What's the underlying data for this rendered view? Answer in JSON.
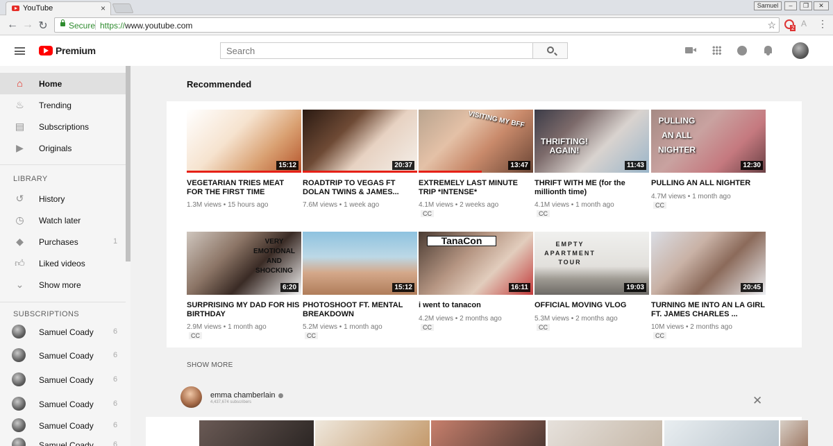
{
  "browser": {
    "tab_title": "YouTube",
    "tab_close": "×",
    "profile_name": "Samuel",
    "secure_label": "Secure",
    "url_scheme": "https://",
    "url_host": "www.youtube.com",
    "ext_badge": "2"
  },
  "header": {
    "brand": "Premium",
    "search_placeholder": "Search"
  },
  "sidebar": {
    "main": [
      {
        "label": "Home",
        "icon": "home-icon"
      },
      {
        "label": "Trending",
        "icon": "flame-icon"
      },
      {
        "label": "Subscriptions",
        "icon": "subscriptions-icon"
      },
      {
        "label": "Originals",
        "icon": "originals-icon"
      }
    ],
    "library_heading": "LIBRARY",
    "library": [
      {
        "label": "History",
        "icon": "history-icon",
        "count": ""
      },
      {
        "label": "Watch later",
        "icon": "clock-icon",
        "count": ""
      },
      {
        "label": "Purchases",
        "icon": "tag-icon",
        "count": "1"
      },
      {
        "label": "Liked videos",
        "icon": "thumbs-up-icon",
        "count": ""
      },
      {
        "label": "Show more",
        "icon": "chevron-down-icon",
        "count": ""
      }
    ],
    "subscriptions_heading": "SUBSCRIPTIONS",
    "subscriptions": [
      {
        "label": "Samuel Coady",
        "count": "6"
      },
      {
        "label": "Samuel Coady",
        "count": "6"
      },
      {
        "label": "Samuel Coady",
        "count": "6"
      },
      {
        "label": "Samuel Coady",
        "count": "6"
      },
      {
        "label": "Samuel Coady",
        "count": "6"
      },
      {
        "label": "Samuel Coady",
        "count": "6"
      }
    ]
  },
  "recommended": {
    "heading": "Recommended",
    "videos": [
      {
        "title": "VEGETARIAN TRIES MEAT FOR THE FIRST TIME",
        "meta": "1.3M views • 15 hours ago",
        "duration": "15:12",
        "cc": "",
        "thumb_text": "",
        "bg": "linear-gradient(135deg,#ffffff 0%,#f6e3cf 40%,#d9a071 70%,#b5542c 100%)"
      },
      {
        "title": "ROADTRIP TO VEGAS FT DOLAN TWINS & JAMES...",
        "meta": "7.6M views • 1 week ago",
        "duration": "20:37",
        "cc": "",
        "thumb_text": "",
        "bg": "linear-gradient(135deg,#2a1a12 0%,#6e4a35 35%,#e7d2c2 60%,#f4efe9 100%)"
      },
      {
        "title": "EXTREMELY LAST MINUTE TRIP *INTENSE*",
        "meta": "4.1M views • 2 weeks ago",
        "duration": "13:47",
        "cc": "CC",
        "thumb_text": "VISITING MY BFF",
        "bg": "linear-gradient(135deg,#b9a48f 0%,#e4c1a7 35%,#c98a6b 60%,#6a4535 100%)"
      },
      {
        "title": "THRIFT WITH ME (for the millionth time)",
        "meta": "4.1M views • 1 month ago",
        "duration": "11:43",
        "cc": "CC",
        "thumb_text": "THRIFTING! AGAIN!",
        "bg": "linear-gradient(135deg,#3c3c48 0%,#7c6a6a 30%,#d9d3cf 60%,#9ab5c9 100%)"
      },
      {
        "title": "PULLING AN ALL NIGHTER",
        "meta": "4.7M views • 1 month ago",
        "duration": "12:30",
        "cc": "CC",
        "thumb_text": "PULLING AN ALL NIGHTER",
        "bg": "linear-gradient(135deg,#a58a84 0%,#c9a2a0 40%,#c5797f 70%,#6a4145 100%)"
      },
      {
        "title": "SURPRISING MY DAD FOR HIS BIRTHDAY",
        "meta": "2.9M views • 1 month ago",
        "duration": "6:20",
        "cc": "CC",
        "thumb_text": "VERY EMOTIONAL AND SHOCKING",
        "bg": "linear-gradient(135deg,#cfc6be 0%,#8c7566 35%,#3a2b25 60%,#f2f2f2 100%)"
      },
      {
        "title": "PHOTOSHOOT FT. MENTAL BREAKDOWN",
        "meta": "5.2M views • 1 month ago",
        "duration": "15:12",
        "cc": "CC",
        "thumb_text": "",
        "bg": "linear-gradient(180deg,#8ec2df 0%,#bcd8e6 40%,#d4a88a 65%,#b07d5a 100%)"
      },
      {
        "title": "i went to tanacon",
        "meta": "4.2M views • 2 months ago",
        "duration": "16:11",
        "cc": "CC",
        "thumb_text": "TanaCon",
        "bg": "linear-gradient(135deg,#4a3b32 0%,#b59582 40%,#e2cdbd 65%,#c23a3a 100%)"
      },
      {
        "title": "OFFICIAL MOVING VLOG",
        "meta": "5.3M views • 2 months ago",
        "duration": "19:03",
        "cc": "CC",
        "thumb_text": "EMPTY APARTMENT TOUR",
        "bg": "linear-gradient(180deg,#f0f0ee 0%,#e2e0dc 55%,#9e9a92 75%,#6d6a66 100%)"
      },
      {
        "title": "TURNING ME INTO AN LA GIRL FT. JAMES CHARLES ...",
        "meta": "10M views • 2 months ago",
        "duration": "20:45",
        "cc": "CC",
        "thumb_text": "",
        "bg": "linear-gradient(135deg,#dadde4 0%,#c9b2a6 35%,#8b6a5a 60%,#eceef2 100%)"
      }
    ],
    "show_more": "SHOW MORE"
  },
  "channel_shelf": {
    "name": "emma chamberlain",
    "subscribers": "4,437,674 subscribers",
    "close": "✕",
    "thumbs": [
      {
        "bg": "linear-gradient(135deg,#6a5a55,#2c2624)"
      },
      {
        "bg": "linear-gradient(135deg,#efe8dd,#c49a6c)"
      },
      {
        "bg": "linear-gradient(135deg,#c77f6c,#4f3a34)"
      },
      {
        "bg": "linear-gradient(135deg,#e6e1dc,#c6b8a8)"
      },
      {
        "bg": "linear-gradient(135deg,#e9eef1,#b9c4cc)"
      },
      {
        "bg": "linear-gradient(135deg,#d8cfc6,#a07c68)"
      }
    ]
  }
}
